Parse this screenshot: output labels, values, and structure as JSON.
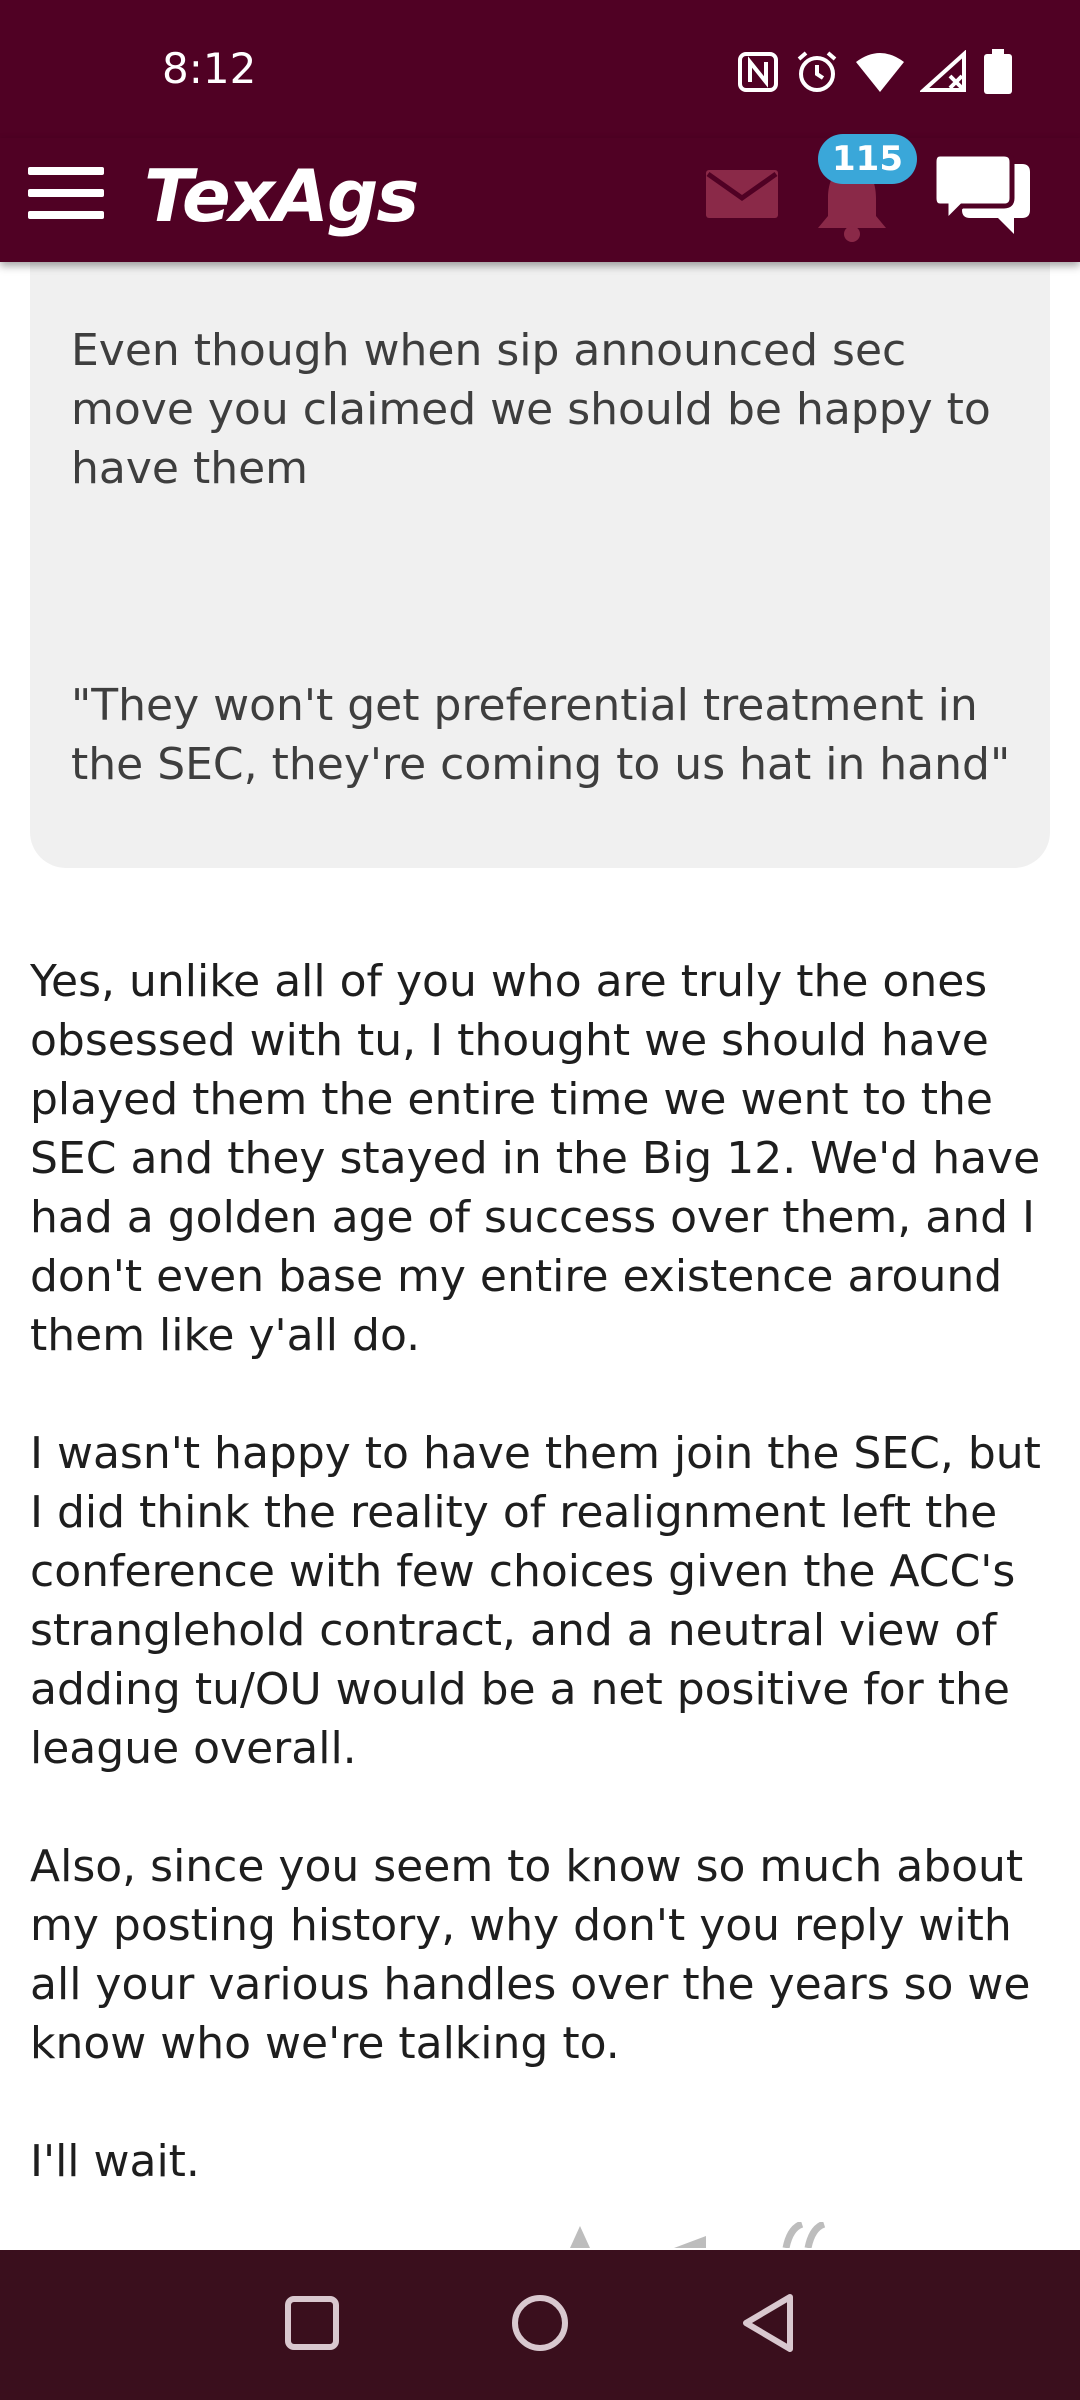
{
  "status_bar": {
    "time": "8:12",
    "icons": [
      "nfc-icon",
      "alarm-icon",
      "wifi-icon",
      "signal-icon",
      "battery-icon"
    ]
  },
  "header": {
    "logo": "TexAgs",
    "notification_count": "115",
    "icons": [
      "menu-icon",
      "mail-icon",
      "bell-icon",
      "chat-icon"
    ],
    "colors": {
      "maroon": "#500124",
      "badge": "#3aa7d9"
    }
  },
  "quote": {
    "paragraphs": [
      "Even though when sip announced sec move you claimed we should be happy to have them",
      "\"They won't get preferential treatment in the SEC, they're coming to us hat in hand\""
    ]
  },
  "post": {
    "paragraphs": [
      "Yes, unlike all of you who are truly the ones obsessed with tu, I thought we should have played them the entire time we went to the SEC and they stayed in the Big 12. We'd have had a golden age of success over them, and I don't even base my entire existence around them like y'all do.",
      "I wasn't happy to have them join the SEC, but I did think the reality of realignment left the conference with few choices given the ACC's stranglehold contract, and a neutral view of adding tu/OU would be a net positive for the league overall.",
      "Also, since you seem to know so much about my posting history, why don't you reply with all your various handles over the years so we know who we're talking to.",
      "I'll wait."
    ]
  },
  "nav_bar": {
    "buttons": [
      "recents-button",
      "home-button",
      "back-button"
    ]
  }
}
